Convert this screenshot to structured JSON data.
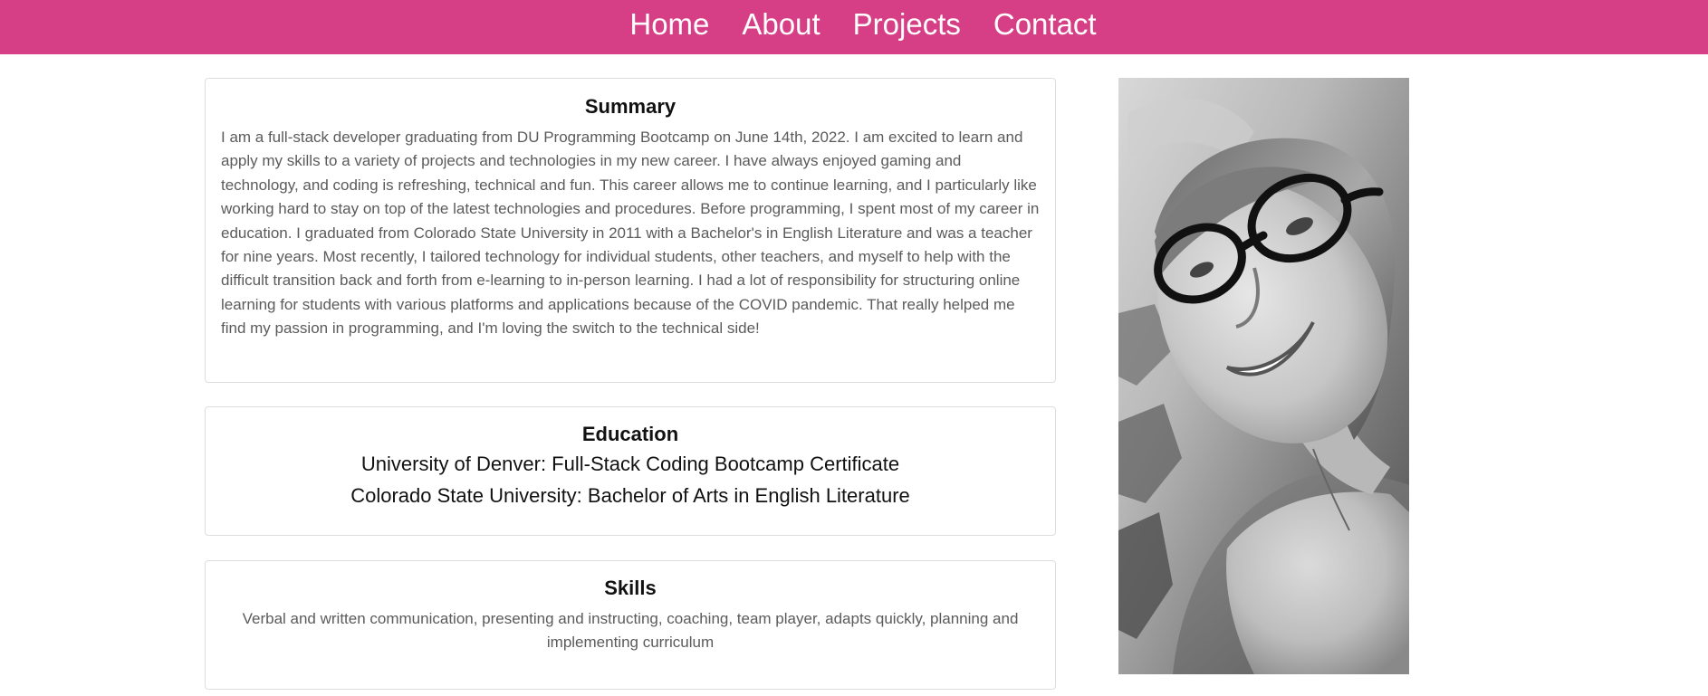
{
  "nav": {
    "items": [
      {
        "label": "Home"
      },
      {
        "label": "About"
      },
      {
        "label": "Projects"
      },
      {
        "label": "Contact"
      }
    ]
  },
  "summary": {
    "title": "Summary",
    "text": "I am a full-stack developer graduating from DU Programming Bootcamp on June 14th, 2022. I am excited to learn and apply my skills to a variety of projects and technologies in my new career. I have always enjoyed gaming and technology, and coding is refreshing, technical and fun. This career allows me to continue learning, and I particularly like working hard to stay on top of the latest technologies and procedures. Before programming, I spent most of my career in education. I graduated from Colorado State University in 2011 with a Bachelor's in English Literature and was a teacher for nine years. Most recently, I tailored technology for individual students, other teachers, and myself to help with the difficult transition back and forth from e-learning to in-person learning. I had a lot of responsibility for structuring online learning for students with various platforms and applications because of the COVID pandemic. That really helped me find my passion in programming, and I'm loving the switch to the technical side!"
  },
  "education": {
    "title": "Education",
    "entries": [
      "University of Denver: Full-Stack Coding Bootcamp Certificate",
      "Colorado State University: Bachelor of Arts in English Literature"
    ]
  },
  "skills": {
    "title": "Skills",
    "text": "Verbal and written communication, presenting and instructing, coaching, team player, adapts quickly, planning and implementing curriculum"
  },
  "colors": {
    "navbar": "#d63f86",
    "nav_text": "#ffffff",
    "body_text": "#5b5b5b",
    "heading_text": "#111111"
  }
}
